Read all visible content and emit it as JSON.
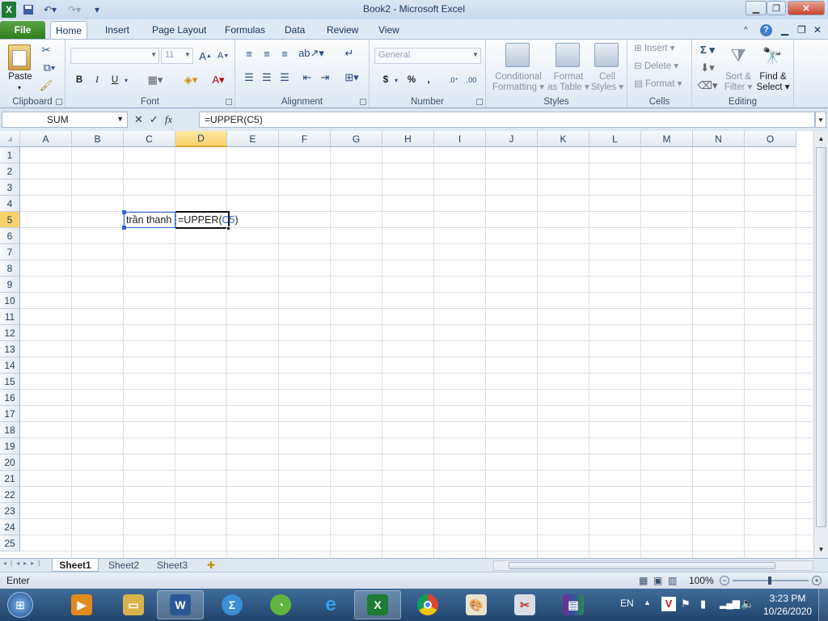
{
  "window": {
    "title": "Book2  -  Microsoft Excel"
  },
  "tabs": [
    "File",
    "Home",
    "Insert",
    "Page Layout",
    "Formulas",
    "Data",
    "Review",
    "View"
  ],
  "ribbon": {
    "clipboard": {
      "label": "Clipboard",
      "paste": "Paste"
    },
    "font": {
      "label": "Font",
      "name": "",
      "size": "11",
      "bold": "B",
      "italic": "I",
      "underline": "U"
    },
    "alignment": {
      "label": "Alignment"
    },
    "number": {
      "label": "Number",
      "format": "General",
      "currency": "$",
      "percent": "%",
      "comma": ","
    },
    "styles": {
      "label": "Styles",
      "conditional": [
        "Conditional",
        "Formatting"
      ],
      "format_table": [
        "Format",
        "as Table"
      ],
      "cell_styles": [
        "Cell",
        "Styles"
      ]
    },
    "cells": {
      "label": "Cells",
      "insert": "Insert",
      "delete": "Delete",
      "format": "Format"
    },
    "editing": {
      "label": "Editing",
      "sort": [
        "Sort &",
        "Filter"
      ],
      "find": [
        "Find &",
        "Select"
      ]
    }
  },
  "formula_bar": {
    "name_box": "SUM",
    "fx": "fx",
    "formula": "=UPPER(C5)"
  },
  "columns": [
    "A",
    "B",
    "C",
    "D",
    "E",
    "F",
    "G",
    "H",
    "I",
    "J",
    "K",
    "L",
    "M",
    "N",
    "O"
  ],
  "rows": [
    "1",
    "2",
    "3",
    "4",
    "5",
    "6",
    "7",
    "8",
    "9",
    "10",
    "11",
    "12",
    "13",
    "14",
    "15",
    "16",
    "17",
    "18",
    "19",
    "20",
    "21",
    "22",
    "23",
    "24",
    "25"
  ],
  "cells": {
    "C5": "trần thanh",
    "D5_prefix": "=UPPER(",
    "D5_ref": "C5",
    "D5_suffix": ")"
  },
  "sheets": [
    "Sheet1",
    "Sheet2",
    "Sheet3"
  ],
  "status": {
    "mode": "Enter",
    "zoom": "100%"
  },
  "taskbar": {
    "lang": "EN",
    "time": "3:23 PM",
    "date": "10/26/2020"
  },
  "colors": {
    "accent": "#2f7d1f",
    "selection": "#f9d26b",
    "ref_blue": "#3265c9"
  }
}
